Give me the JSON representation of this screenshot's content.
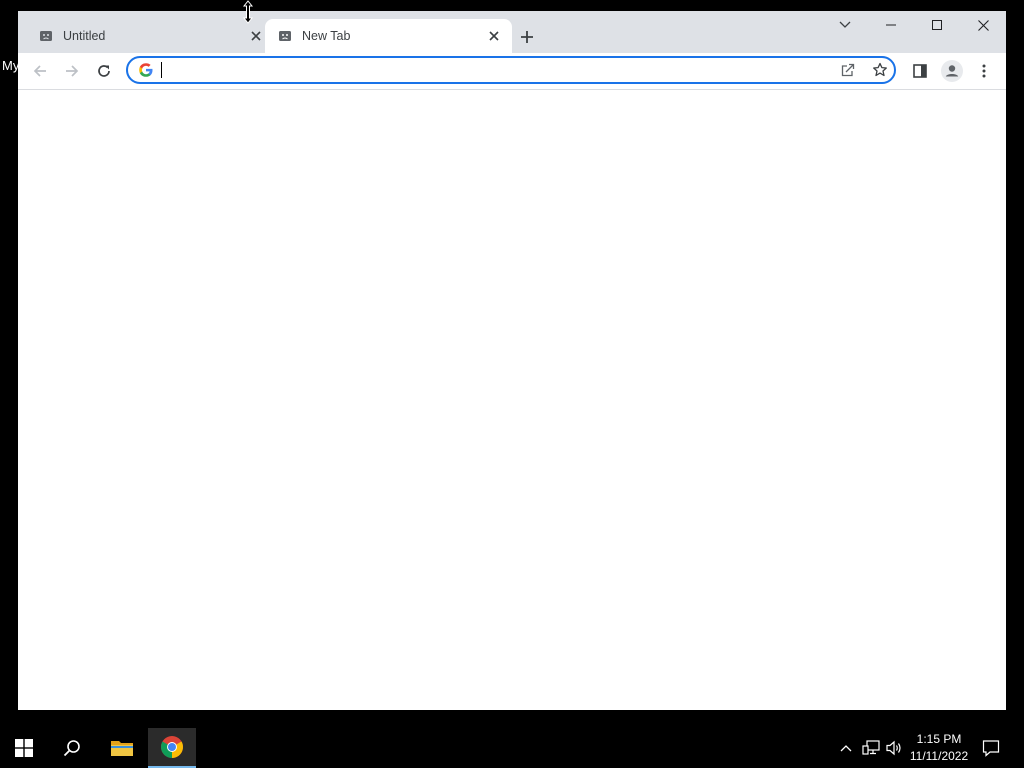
{
  "desktop": {
    "label": "My"
  },
  "browser": {
    "tabs": [
      {
        "title": "Untitled",
        "active": false,
        "favicon": "broken-page-icon"
      },
      {
        "title": "New Tab",
        "active": true,
        "favicon": "broken-page-icon"
      }
    ],
    "new_tab_icon": "plus-icon",
    "window_controls": [
      "tab-search-icon",
      "minimize-icon",
      "maximize-icon",
      "close-icon"
    ],
    "toolbar": {
      "back_icon": "back-arrow-icon",
      "forward_icon": "forward-arrow-icon",
      "reload_icon": "reload-icon",
      "side_panel_icon": "side-panel-icon",
      "profile_icon": "profile-avatar-icon",
      "menu_icon": "kebab-menu-icon"
    },
    "omnibox": {
      "value": "",
      "placeholder": "",
      "search_engine_icon": "google-g-icon",
      "share_icon": "share-icon",
      "bookmark_icon": "star-icon"
    },
    "colors": {
      "tab_strip": "#dee1e6",
      "focus_ring": "#1a73e8",
      "google_blue": "#4285f4",
      "google_red": "#ea4335",
      "google_yellow": "#fbbc05",
      "google_green": "#34a853"
    }
  },
  "taskbar": {
    "start_icon": "windows-logo-icon",
    "search_icon": "search-icon",
    "pinned": [
      {
        "name": "file-explorer-icon",
        "active": false
      },
      {
        "name": "chrome-icon",
        "active": true
      }
    ],
    "tray": {
      "overflow_icon": "chevron-up-icon",
      "network_icon": "network-icon",
      "volume_icon": "volume-icon",
      "time": "1:15 PM",
      "date": "11/11/2022",
      "notifications_icon": "notifications-icon"
    },
    "colors": {
      "active_underline": "#76b9ed",
      "folder_yellow": "#f0c542"
    }
  }
}
